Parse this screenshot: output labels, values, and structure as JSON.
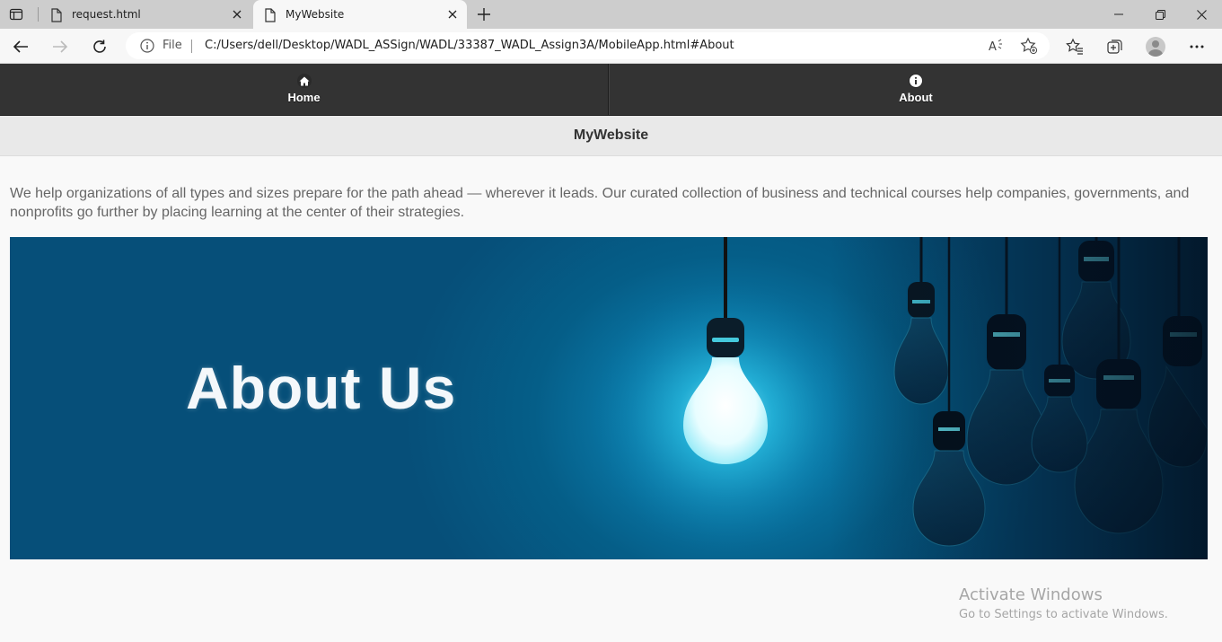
{
  "browser": {
    "tabs": [
      {
        "title": "request.html",
        "icon": "page-icon"
      },
      {
        "title": "MyWebsite",
        "icon": "page-icon",
        "active": true
      }
    ],
    "address": {
      "scheme_label": "File",
      "url": "C:/Users/dell/Desktop/WADL_ASSign/WADL/33387_WADL_Assign3A/MobileApp.html#About"
    }
  },
  "nav": {
    "items": [
      {
        "label": "Home",
        "icon": "home-icon"
      },
      {
        "label": "About",
        "icon": "info-icon"
      }
    ]
  },
  "header": {
    "title": "MyWebsite"
  },
  "content": {
    "paragraph": "We help organizations of all types and sizes prepare for the path ahead — wherever it leads. Our curated collection of business and technical courses help companies, governments, and nonprofits go further by placing learning at the center of their strategies.",
    "banner_title": "About Us"
  },
  "watermark": {
    "line1": "Activate Windows",
    "line2": "Go to Settings to activate Windows."
  },
  "colors": {
    "navbar": "#333333",
    "header": "#e9e9e9",
    "banner": "#064f79"
  }
}
